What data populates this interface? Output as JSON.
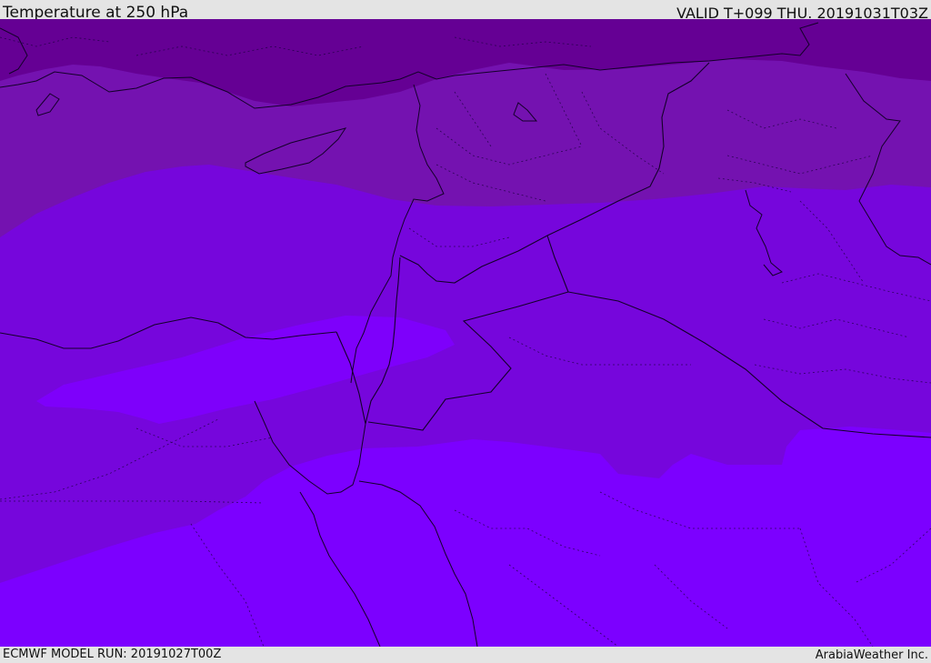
{
  "header": {
    "title": "Temperature at 250 hPa",
    "valid_time": "VALID T+099 THU. 20191031T03Z"
  },
  "footer": {
    "model_run": "ECMWF MODEL RUN: 20191027T00Z",
    "credit": "ArabiaWeather Inc."
  },
  "map": {
    "variable": "Temperature at 250 hPa",
    "palette": {
      "darkest": "#650094",
      "darker": "#7212ae",
      "mid": "#7c06d6",
      "light": "#7d00f2",
      "lightest": "#7c00ff",
      "borders": "#1a0030"
    }
  }
}
